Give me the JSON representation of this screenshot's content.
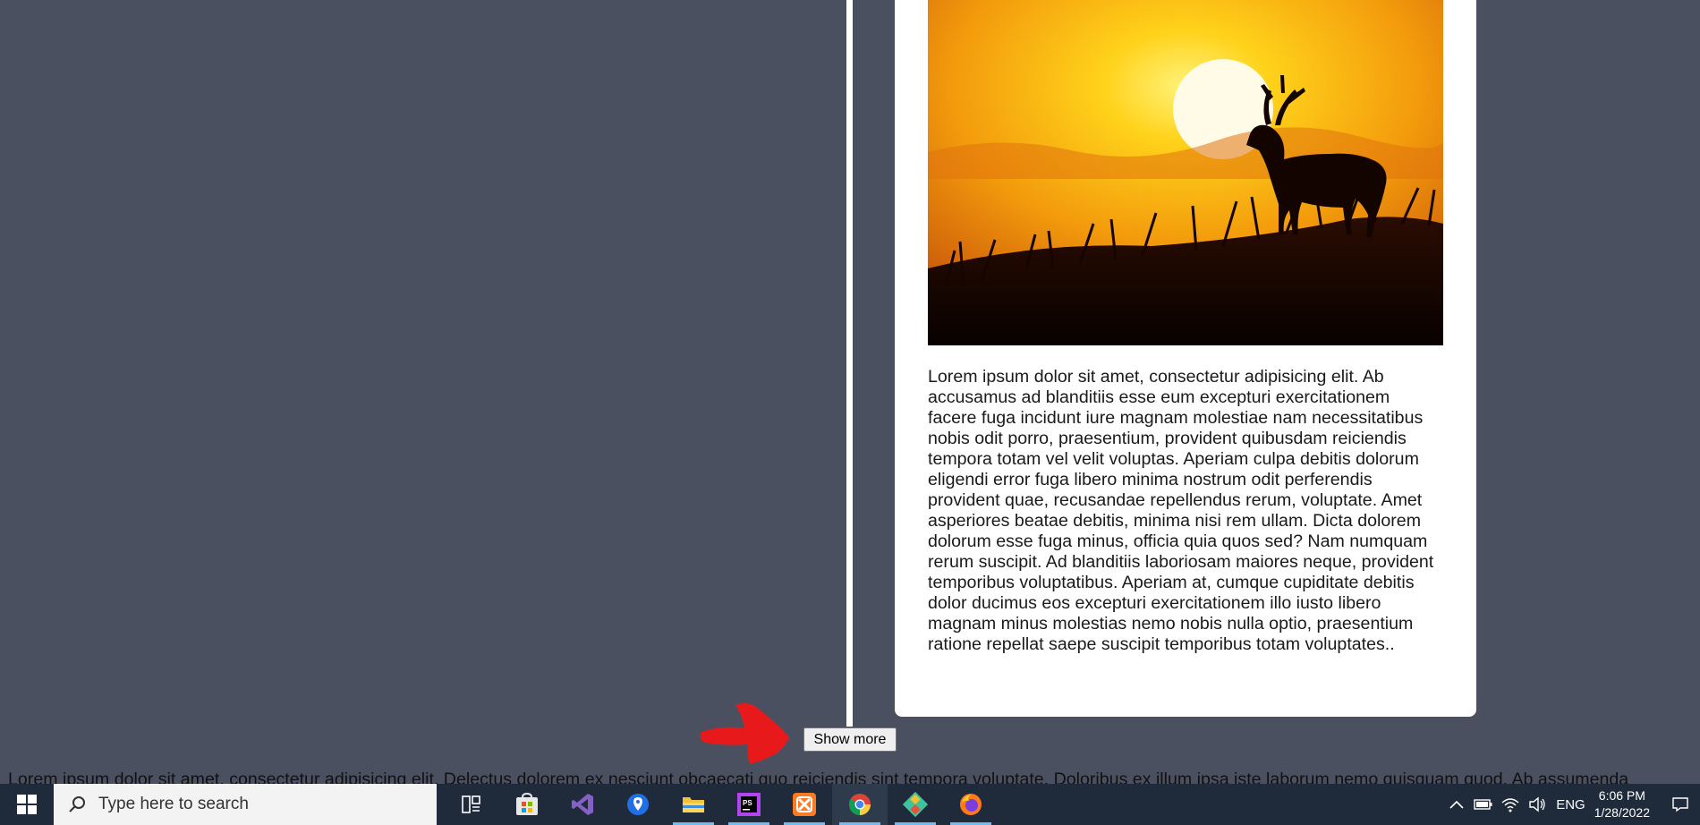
{
  "card": {
    "image_alt": "Deer silhouette at sunset",
    "paragraph": "Lorem ipsum dolor sit amet, consectetur adipisicing elit. Ab accusamus ad blanditiis esse eum excepturi exercitationem facere fuga incidunt iure magnam molestiae nam necessitatibus nobis odit porro, praesentium, provident quibusdam reiciendis tempora totam vel velit voluptas. Aperiam culpa debitis dolorum eligendi error fuga libero minima nostrum odit perferendis provident quae, recusandae repellendus rerum, voluptate. Amet asperiores beatae debitis, minima nisi rem ullam. Dicta dolorem dolorum esse fuga minus, officia quia quos sed? Nam numquam rerum suscipit. Ad blanditiis laboriosam maiores neque, provident temporibus voluptatibus. Aperiam at, cumque cupiditate debitis dolor ducimus eos excepturi exercitationem illo iusto libero magnam minus molestias nemo nobis nulla optio, praesentium ratione repellat saepe suscipit temporibus totam voluptates.."
  },
  "show_more_label": "Show more",
  "bottom_text": "Lorem ipsum dolor sit amet, consectetur adipisicing elit. Delectus dolorem ex nesciunt obcaecati quo reiciendis sint tempora voluptate. Doloribus ex illum ipsa iste laborum nemo quisquam quod. Ab assumenda",
  "taskbar": {
    "search_placeholder": "Type here to search",
    "apps": [
      {
        "name": "task-view-icon"
      },
      {
        "name": "microsoft-store-icon"
      },
      {
        "name": "visual-studio-icon"
      },
      {
        "name": "maps-icon"
      },
      {
        "name": "file-explorer-icon"
      },
      {
        "name": "phpstorm-icon"
      },
      {
        "name": "xampp-icon"
      },
      {
        "name": "chrome-icon"
      },
      {
        "name": "git-icon"
      },
      {
        "name": "firefox-icon"
      }
    ],
    "tray": {
      "language": "ENG",
      "time": "6:06 PM",
      "date": "1/28/2022"
    }
  },
  "colors": {
    "page_background": "#4a5060",
    "taskbar": "#1f2b3a",
    "annotation": "#e8191b"
  }
}
